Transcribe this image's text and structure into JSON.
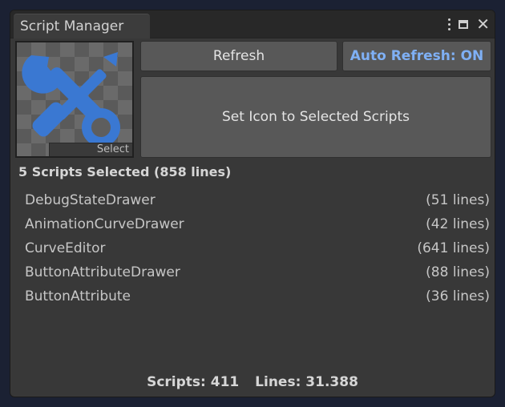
{
  "window": {
    "tab_title": "Script Manager",
    "controls": {
      "menu_icon": "kebab-menu-icon",
      "maximize_icon": "maximize-icon",
      "close_icon": "close-icon",
      "close_glyph": "✕"
    }
  },
  "icon_preview": {
    "icon": "wrench-screwdriver-icon",
    "icon_color": "#3a78d2",
    "select_label": "Select"
  },
  "toolbar": {
    "refresh_label": "Refresh",
    "auto_refresh_label": "Auto Refresh: ON",
    "auto_refresh_color": "#7fb0f5",
    "set_icon_label": "Set Icon to Selected Scripts"
  },
  "selection": {
    "title": "5 Scripts Selected (858 lines)",
    "scripts": [
      {
        "name": "DebugStateDrawer",
        "lines": "(51 lines)"
      },
      {
        "name": "AnimationCurveDrawer",
        "lines": "(42 lines)"
      },
      {
        "name": "CurveEditor",
        "lines": "(641 lines)"
      },
      {
        "name": "ButtonAttributeDrawer",
        "lines": "(88 lines)"
      },
      {
        "name": "ButtonAttribute",
        "lines": "(36 lines)"
      }
    ]
  },
  "footer": {
    "scripts_count": "Scripts: 411",
    "lines_count": "Lines: 31.388"
  }
}
